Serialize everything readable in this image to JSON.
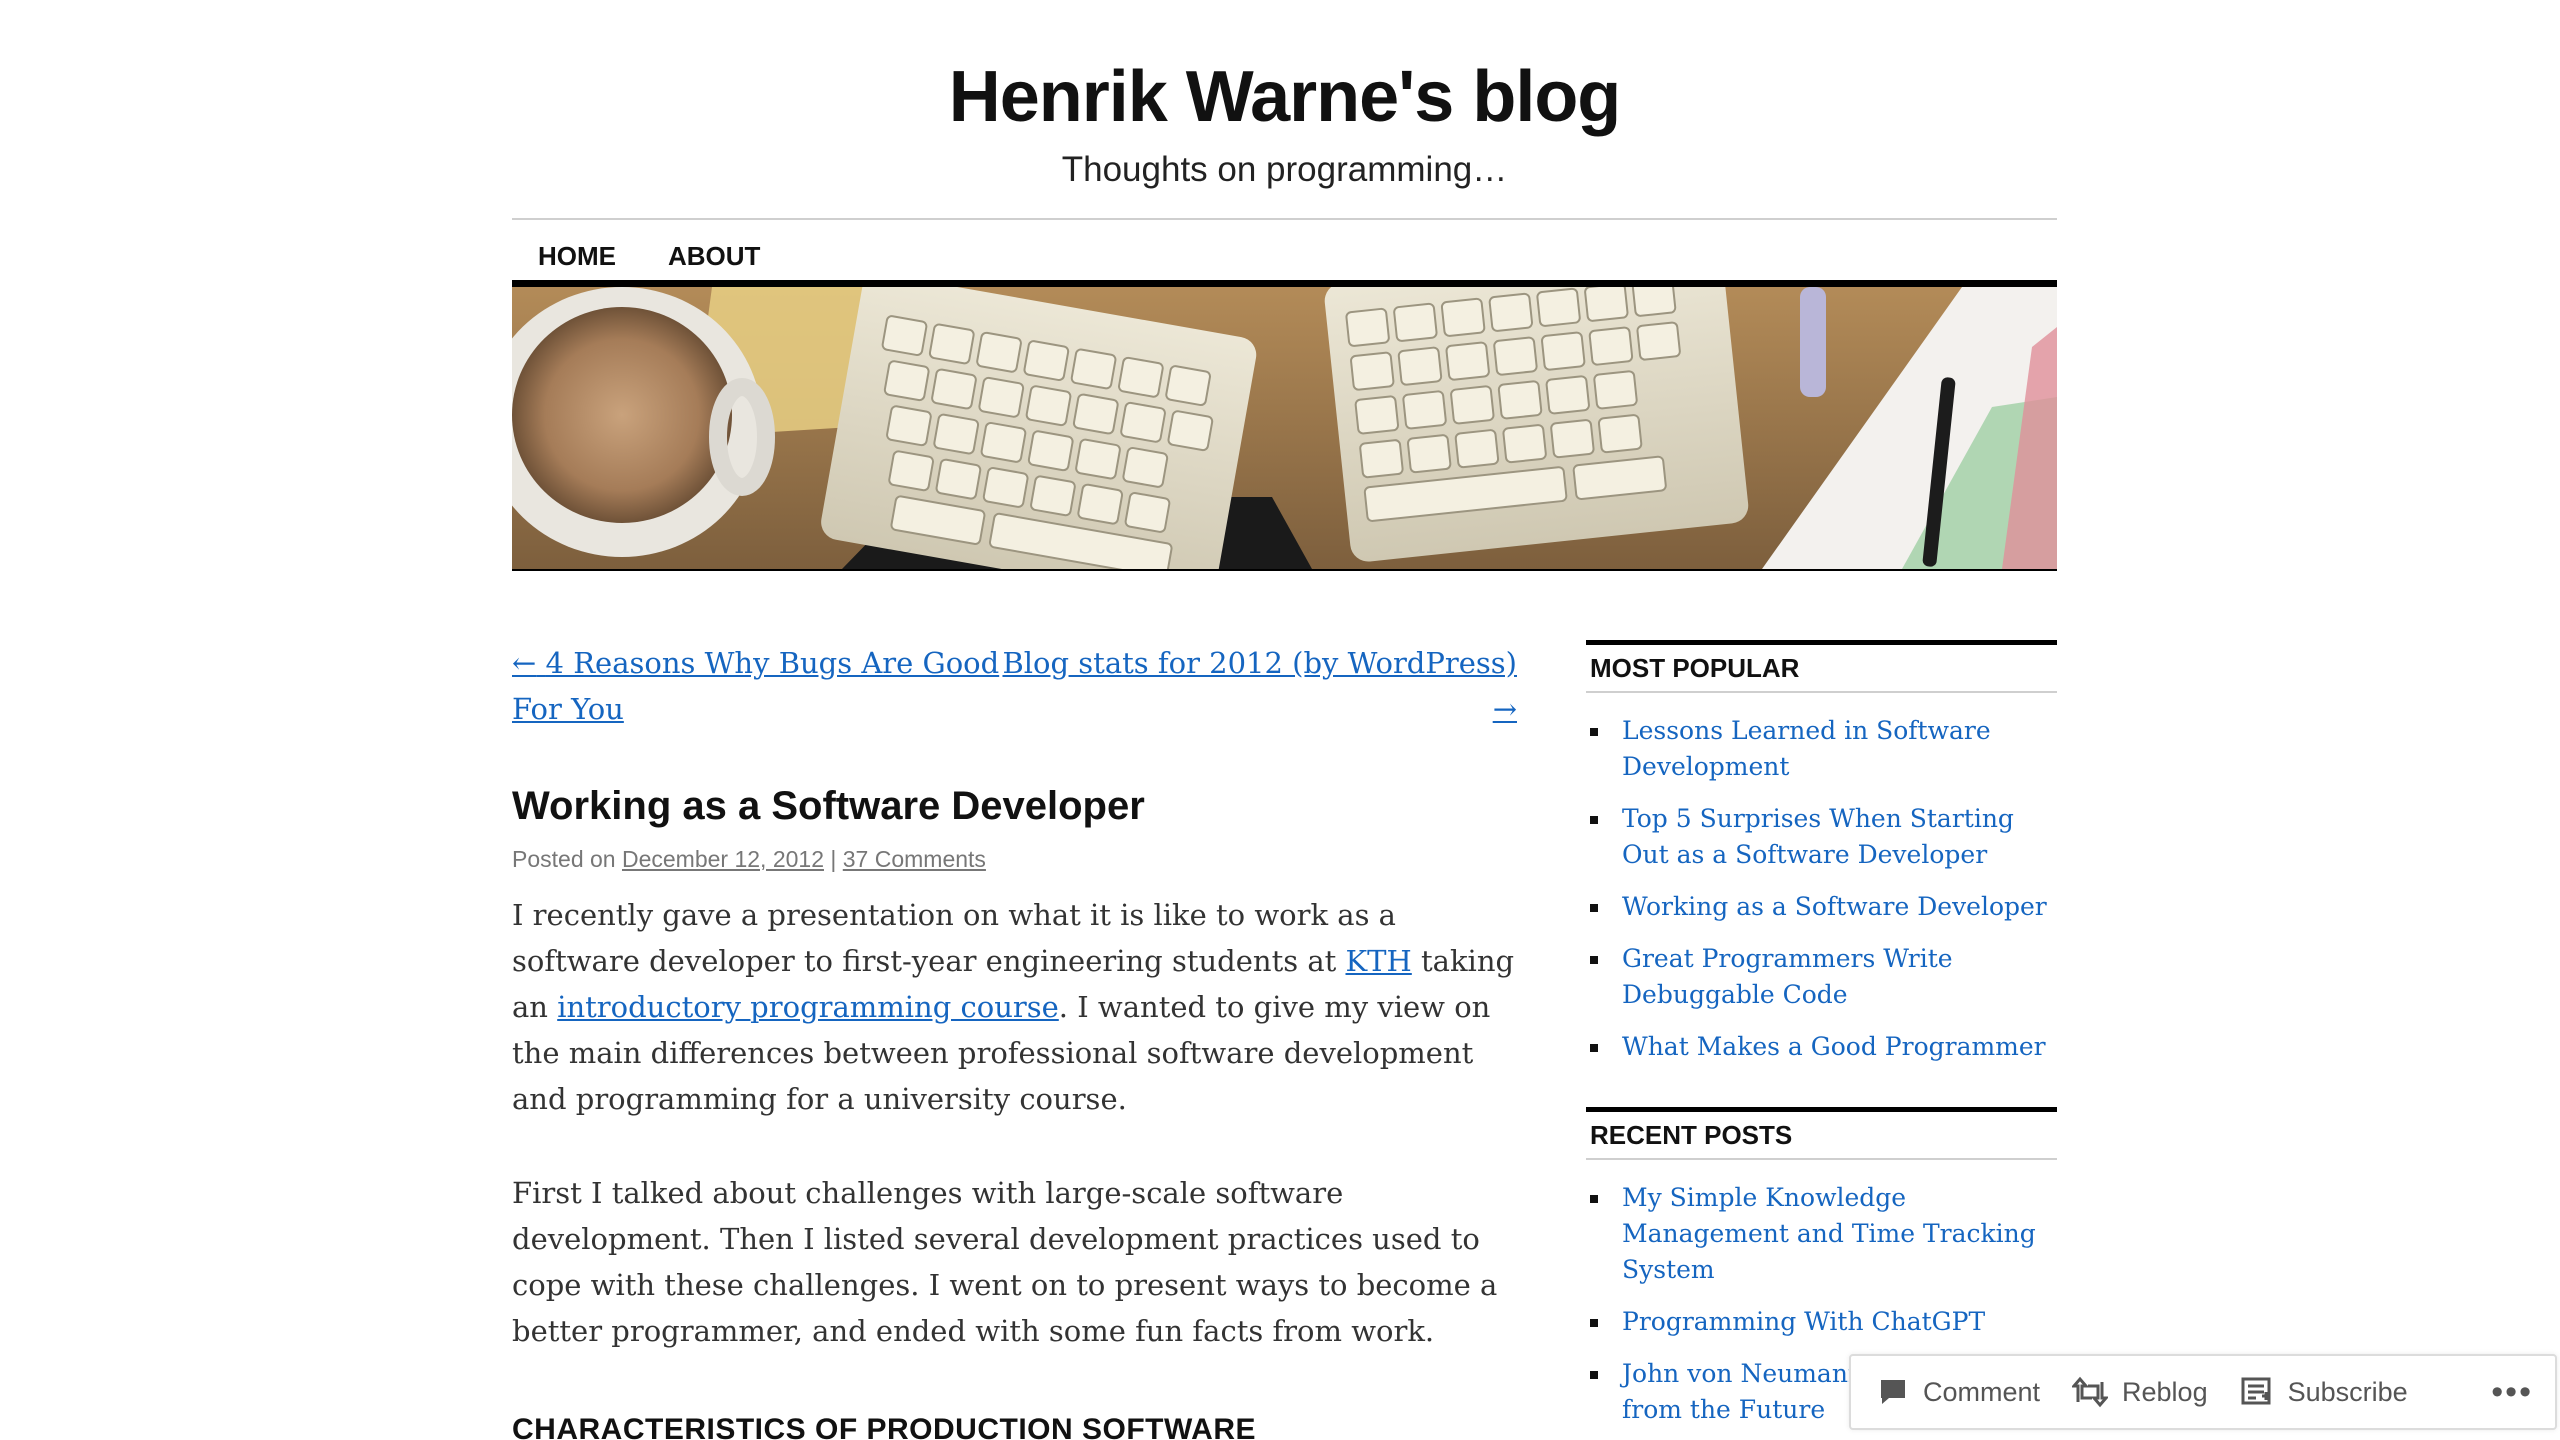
{
  "site": {
    "title": "Henrik Warne's blog",
    "description": "Thoughts on programming…"
  },
  "nav": {
    "items": [
      {
        "label": "HOME"
      },
      {
        "label": "ABOUT"
      }
    ]
  },
  "post_nav": {
    "prev_arrow": "←",
    "prev_label": "4 Reasons Why Bugs Are Good For You",
    "next_label": "Blog stats for 2012 (by WordPress)",
    "next_arrow": "→"
  },
  "post": {
    "title": "Working as a Software Developer",
    "meta_prefix": "Posted on",
    "date": "December 12, 2012",
    "separator": "|",
    "comments": "37 Comments",
    "p1_a": "I recently gave a presentation on what it is like to work as a software developer to first-year engineering students at ",
    "p1_link1": "KTH",
    "p1_b": " taking an ",
    "p1_link2": "introductory programming course",
    "p1_c": ". I wanted to give my view on the main differences between professional software development and programming for a university course.",
    "p2": "First I talked about challenges with large-scale software development. Then I listed several development practices used to cope with these challenges. I went on to present ways to become a better programmer, and ended with some fun facts from work.",
    "section_heading": "CHARACTERISTICS OF PRODUCTION SOFTWARE"
  },
  "sidebar": {
    "popular": {
      "title": "MOST POPULAR",
      "items": [
        {
          "label": "Lessons Learned in Software Development"
        },
        {
          "label": "Top 5 Surprises When Starting Out as a Software Developer"
        },
        {
          "label": "Working as a Software Developer"
        },
        {
          "label": "Great Programmers Write Debuggable Code"
        },
        {
          "label": "What Makes a Good Programmer"
        }
      ]
    },
    "recent": {
      "title": "RECENT POSTS",
      "items": [
        {
          "label": "My Simple Knowledge Management and Time Tracking System"
        },
        {
          "label": "Programming With ChatGPT"
        },
        {
          "label": "John von Neumann – The Man from the Future"
        }
      ]
    }
  },
  "actionbar": {
    "comment": "Comment",
    "reblog": "Reblog",
    "subscribe": "Subscribe",
    "more": "•••"
  },
  "colors": {
    "link": "#1565c0",
    "text": "#333333",
    "meta": "#777777"
  }
}
